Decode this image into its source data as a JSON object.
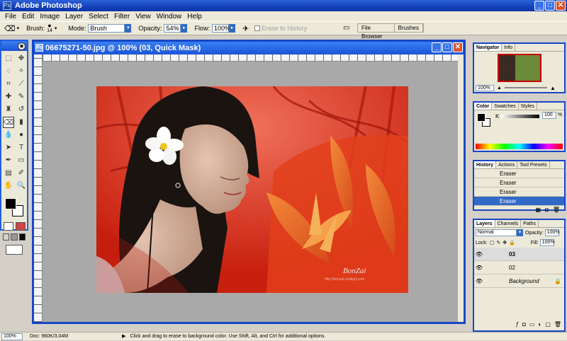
{
  "app": {
    "title": "Adobe Photoshop"
  },
  "menu": [
    "File",
    "Edit",
    "Image",
    "Layer",
    "Select",
    "Filter",
    "View",
    "Window",
    "Help"
  ],
  "options": {
    "brush_label": "Brush:",
    "brush_size": "14",
    "mode_label": "Mode:",
    "mode_value": "Brush",
    "opacity_label": "Opacity:",
    "opacity_value": "54%",
    "flow_label": "Flow:",
    "flow_value": "100%",
    "erase_history": "Erase to History"
  },
  "palette_well": {
    "tabs": [
      "File Browser",
      "Brushes"
    ]
  },
  "document": {
    "title": "06675271-50.jpg @ 100% (03, Quick Mask)",
    "watermark": "BonZai",
    "watermark_url": "http://bonzai.multiply.com"
  },
  "navigator": {
    "tabs": [
      "Navigator",
      "Info"
    ],
    "zoom": "100%"
  },
  "color": {
    "tabs": [
      "Color",
      "Swatches",
      "Styles"
    ],
    "channel": "K",
    "value": "100",
    "unit": "%"
  },
  "history": {
    "tabs": [
      "History",
      "Actions",
      "Tool Presets"
    ],
    "items": [
      "Eraser",
      "Eraser",
      "Eraser",
      "Eraser"
    ],
    "selected_index": 3
  },
  "layers": {
    "tabs": [
      "Layers",
      "Channels",
      "Paths"
    ],
    "blend": "Normal",
    "opacity_label": "Opacity:",
    "opacity": "100%",
    "lock_label": "Lock:",
    "fill_label": "Fill:",
    "fill": "100%",
    "items": [
      "03",
      "02",
      "Background"
    ]
  },
  "status": {
    "zoom": "100%",
    "doc": "Doc: 960K/3.04M",
    "hint": "Click and drag to erase to background color. Use Shift, Alt, and Ctrl for additional options."
  }
}
